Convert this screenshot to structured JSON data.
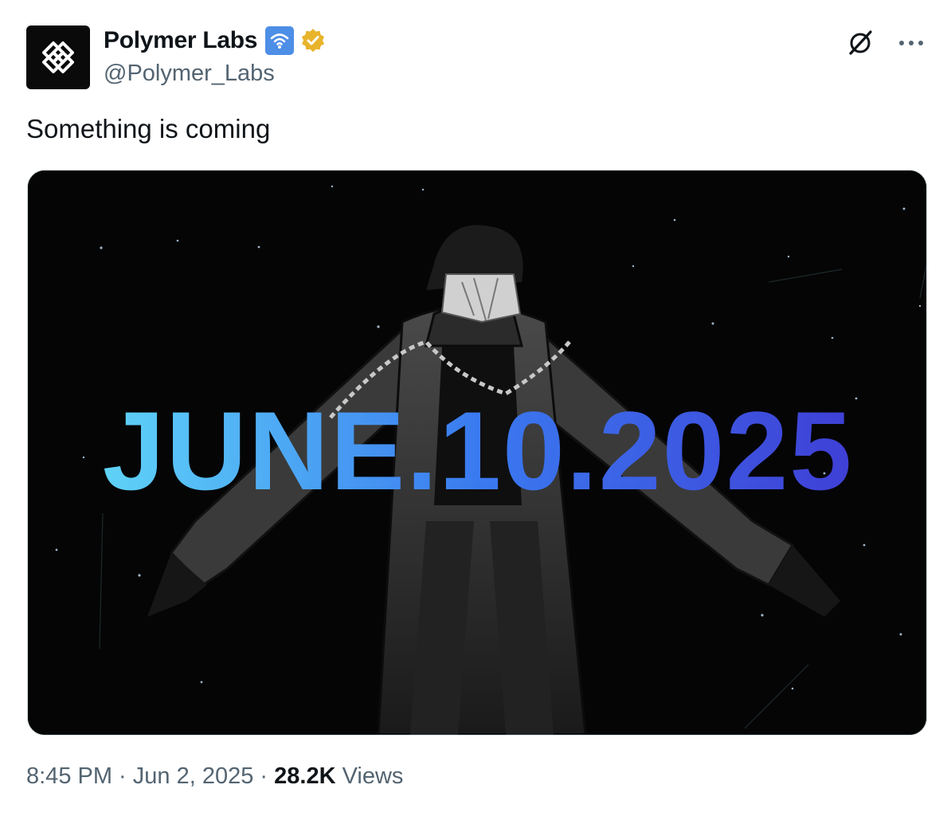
{
  "author": {
    "display_name": "Polymer Labs",
    "handle": "@Polymer_Labs",
    "avatar_icon": "polymer-logo-icon",
    "badges": [
      "wifi-badge-icon",
      "verified-gold-badge-icon"
    ],
    "badge_colors": {
      "wifi": "#4d8ee6",
      "verified": "#e8b42c"
    }
  },
  "actions": {
    "grok_icon": "grok-slash-icon",
    "more_icon": "more-dots-icon"
  },
  "tweet": {
    "text": "Something is coming"
  },
  "media": {
    "overlay_text": "JUNE.10.2025",
    "gradient_colors": [
      "#5fd3f7",
      "#3a7af0",
      "#3f3fd6"
    ],
    "background": "#050505"
  },
  "meta": {
    "time": "8:45 PM",
    "separator": " · ",
    "date": "Jun 2, 2025",
    "views_count": "28.2K",
    "views_label": " Views"
  }
}
